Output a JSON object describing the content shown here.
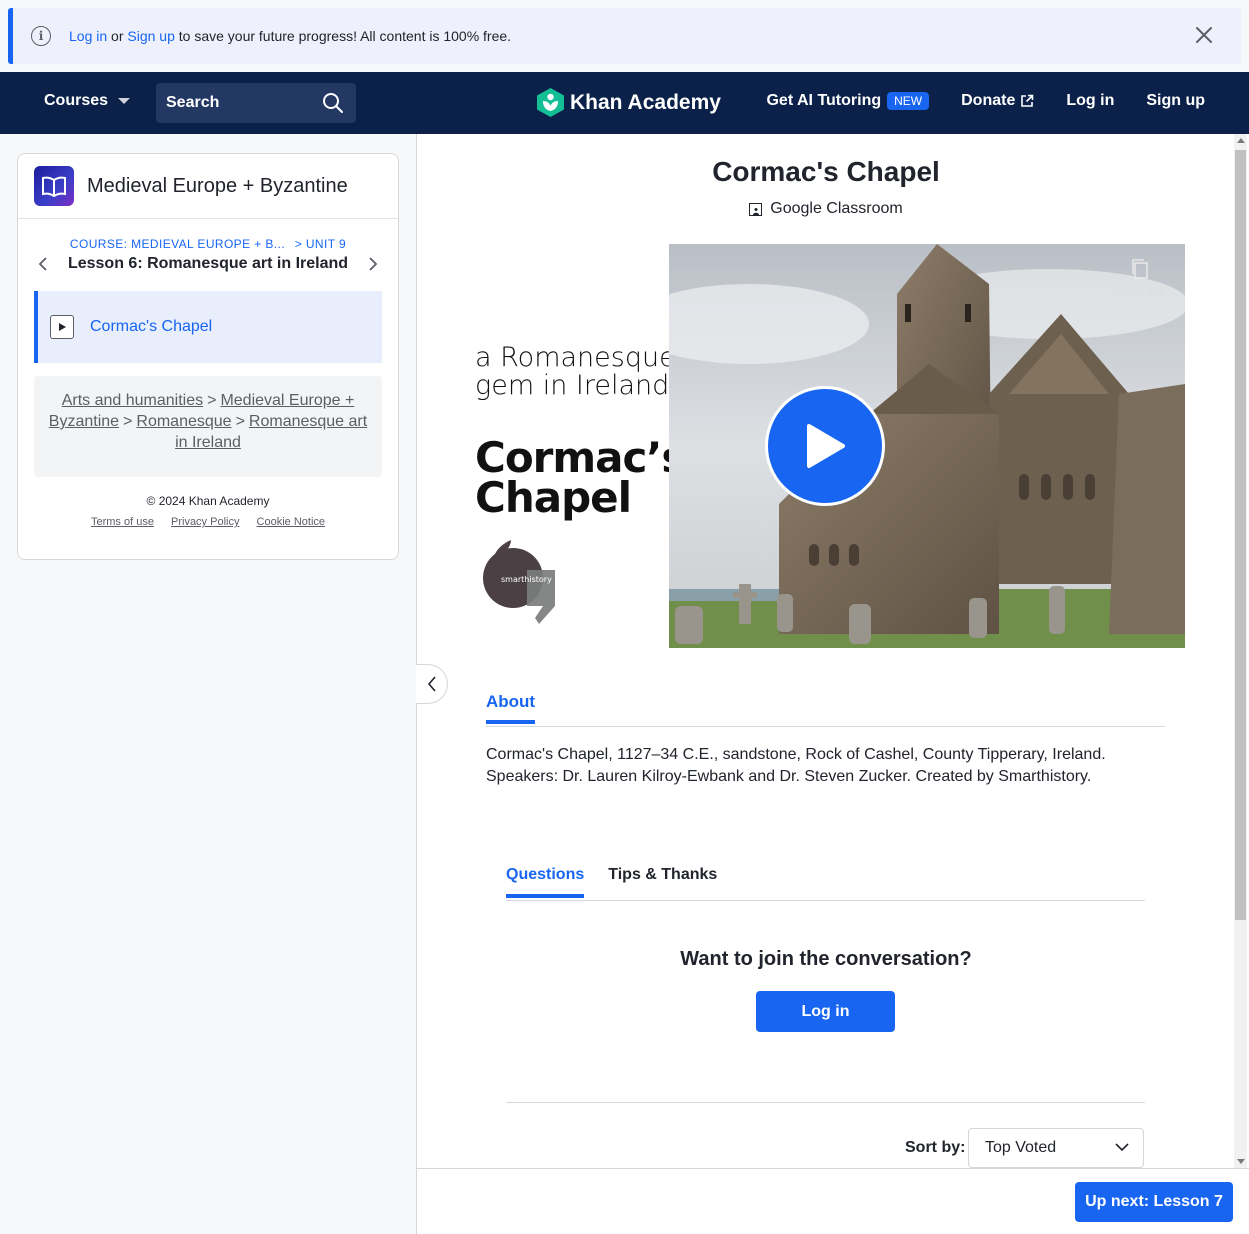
{
  "banner": {
    "login_link": "Log in",
    "or_text": " or ",
    "signup_link": "Sign up",
    "message": " to save your future progress! All content is 100% free."
  },
  "nav": {
    "courses": "Courses",
    "search_label": "Search",
    "logo_text": "Khan Academy",
    "ai_tutoring": "Get AI Tutoring",
    "new_badge": "NEW",
    "donate": "Donate",
    "login": "Log in",
    "signup": "Sign up"
  },
  "sidebar": {
    "course_title": "Medieval Europe + Byzantine",
    "course_crumb": "COURSE: MEDIEVAL EUROPE + B...",
    "unit_crumb": "> UNIT 9",
    "lesson_title": "Lesson 6: Romanesque art in Ireland",
    "current_item": "Cormac's Chapel",
    "breadcrumbs": [
      "Arts and humanities",
      "Medieval Europe + Byzantine",
      "Romanesque",
      "Romanesque art in Ireland"
    ],
    "copyright": "© 2024 Khan Academy",
    "legal": [
      "Terms of use",
      "Privacy Policy",
      "Cookie Notice"
    ]
  },
  "video": {
    "title": "Cormac's Chapel",
    "google_classroom": "Google Classroom",
    "slide_subtitle_1": "a Romanesque",
    "slide_subtitle_2": "gem in Ireland",
    "slide_title_1": "Cormac’s",
    "slide_title_2": "Chapel",
    "smarthistory_mark": "smarthistory",
    "copy_link": "Copy link"
  },
  "about": {
    "tab_label": "About",
    "description": "Cormac's Chapel, 1127–34 C.E., sandstone, Rock of Cashel, County Tipperary, Ireland. Speakers: Dr. Lauren Kilroy-Ewbank and Dr. Steven Zucker. Created by Smarthistory."
  },
  "discussion": {
    "tabs": [
      "Questions",
      "Tips & Thanks"
    ],
    "join_prompt": "Want to join the conversation?",
    "login_button": "Log in",
    "sort_label": "Sort by:",
    "sort_value": "Top Voted"
  },
  "footer": {
    "up_next": "Up next: Lesson 7"
  },
  "colors": {
    "accent": "#1865f2",
    "nav_bg": "#0b2149",
    "logo_green": "#14bf96"
  }
}
